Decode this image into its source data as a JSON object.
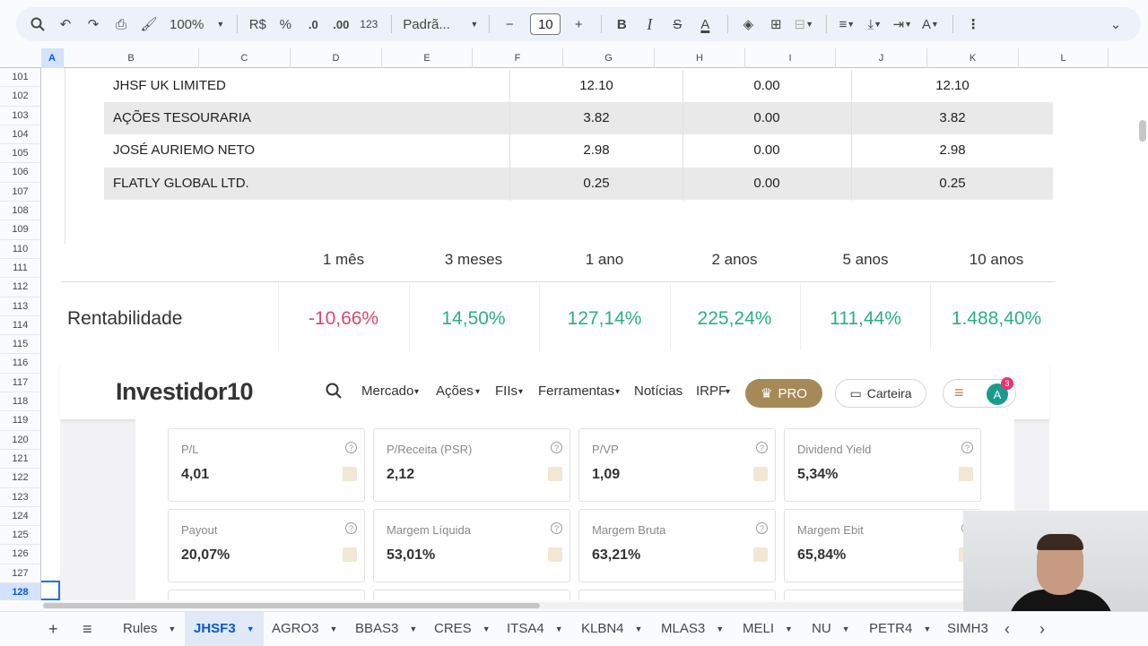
{
  "toolbar": {
    "zoom": "100%",
    "currency": "R$",
    "percent": "%",
    "dec_less": ".0",
    "dec_more": ".00",
    "number_format": "123",
    "font": "Padrã...",
    "font_size": "10"
  },
  "columns": [
    "A",
    "B",
    "C",
    "D",
    "E",
    "F",
    "G",
    "H",
    "I",
    "J",
    "K",
    "L"
  ],
  "rows": [
    "101",
    "102",
    "103",
    "104",
    "105",
    "106",
    "107",
    "108",
    "109",
    "110",
    "111",
    "112",
    "113",
    "114",
    "115",
    "116",
    "117",
    "118",
    "119",
    "120",
    "121",
    "122",
    "123",
    "124",
    "125",
    "126",
    "127",
    "128"
  ],
  "shareholders": [
    {
      "name": "JHSF UK LIMITED",
      "v1": "12.10",
      "v2": "0.00",
      "v3": "12.10"
    },
    {
      "name": "AÇÕES TESOURARIA",
      "v1": "3.82",
      "v2": "0.00",
      "v3": "3.82"
    },
    {
      "name": "JOSÉ AURIEMO NETO",
      "v1": "2.98",
      "v2": "0.00",
      "v3": "2.98"
    },
    {
      "name": "FLATLY GLOBAL LTD.",
      "v1": "0.25",
      "v2": "0.00",
      "v3": "0.25"
    }
  ],
  "rentabilidade": {
    "label": "Rentabilidade",
    "periods": [
      "1 mês",
      "3 meses",
      "1 ano",
      "2 anos",
      "5 anos",
      "10 anos"
    ],
    "values": [
      "-10,66%",
      "14,50%",
      "127,14%",
      "225,24%",
      "111,44%",
      "1.488,40%"
    ]
  },
  "investidor": {
    "logo": "Investidor10",
    "nav": [
      "Mercado",
      "Ações",
      "FIIs",
      "Ferramentas",
      "Notícias",
      "IRPF"
    ],
    "pro": "PRO",
    "carteira": "Carteira",
    "avatar": "A",
    "notifications": "3",
    "cards": [
      {
        "title": "P/L",
        "value": "4,01"
      },
      {
        "title": "P/Receita (PSR)",
        "value": "2,12"
      },
      {
        "title": "P/VP",
        "value": "1,09"
      },
      {
        "title": "Dividend Yield",
        "value": "5,34%"
      },
      {
        "title": "Payout",
        "value": "20,07%"
      },
      {
        "title": "Margem Líquida",
        "value": "53,01%"
      },
      {
        "title": "Margem Bruta",
        "value": "63,21%"
      },
      {
        "title": "Margem Ebit",
        "value": "65,84%"
      }
    ]
  },
  "tabs": [
    "Rules",
    "JHSF3",
    "AGRO3",
    "BBAS3",
    "CRES",
    "ITSA4",
    "KLBN4",
    "MLAS3",
    "MELI",
    "NU",
    "PETR4",
    "SIMH3"
  ],
  "active_tab": "JHSF3"
}
